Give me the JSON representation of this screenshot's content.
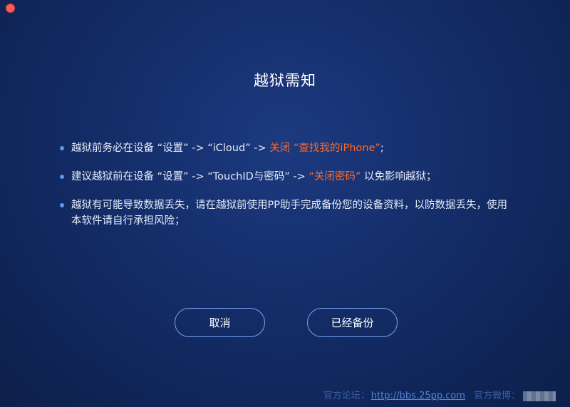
{
  "window": {
    "close_color": "#fc5b57"
  },
  "dialog": {
    "title": "越狱需知",
    "notices": [
      {
        "parts": [
          "越狱前务必在设备 “设置” -> “iCloud” -> ",
          "关闭 “查找我的iPhone”",
          ";"
        ]
      },
      {
        "parts": [
          "建议越狱前在设备 “设置” -> “TouchID与密码” -> ",
          "“关闭密码”",
          " 以免影响越狱；"
        ]
      },
      {
        "parts": [
          "越狱有可能导致数据丢失，请在越狱前使用PP助手完成备份您的设备资料，以防数据丢失，使用本软件请自行承担风险；"
        ]
      }
    ],
    "buttons": {
      "cancel": "取消",
      "confirm": "已经备份"
    }
  },
  "footer": {
    "forum_label": "官方论坛：",
    "forum_link": "http://bbs.25pp.com",
    "weibo_label": "官方微博："
  },
  "colors": {
    "background": "#142d68",
    "highlight": "#ff6a2b",
    "button_border": "#7aa3ef"
  }
}
